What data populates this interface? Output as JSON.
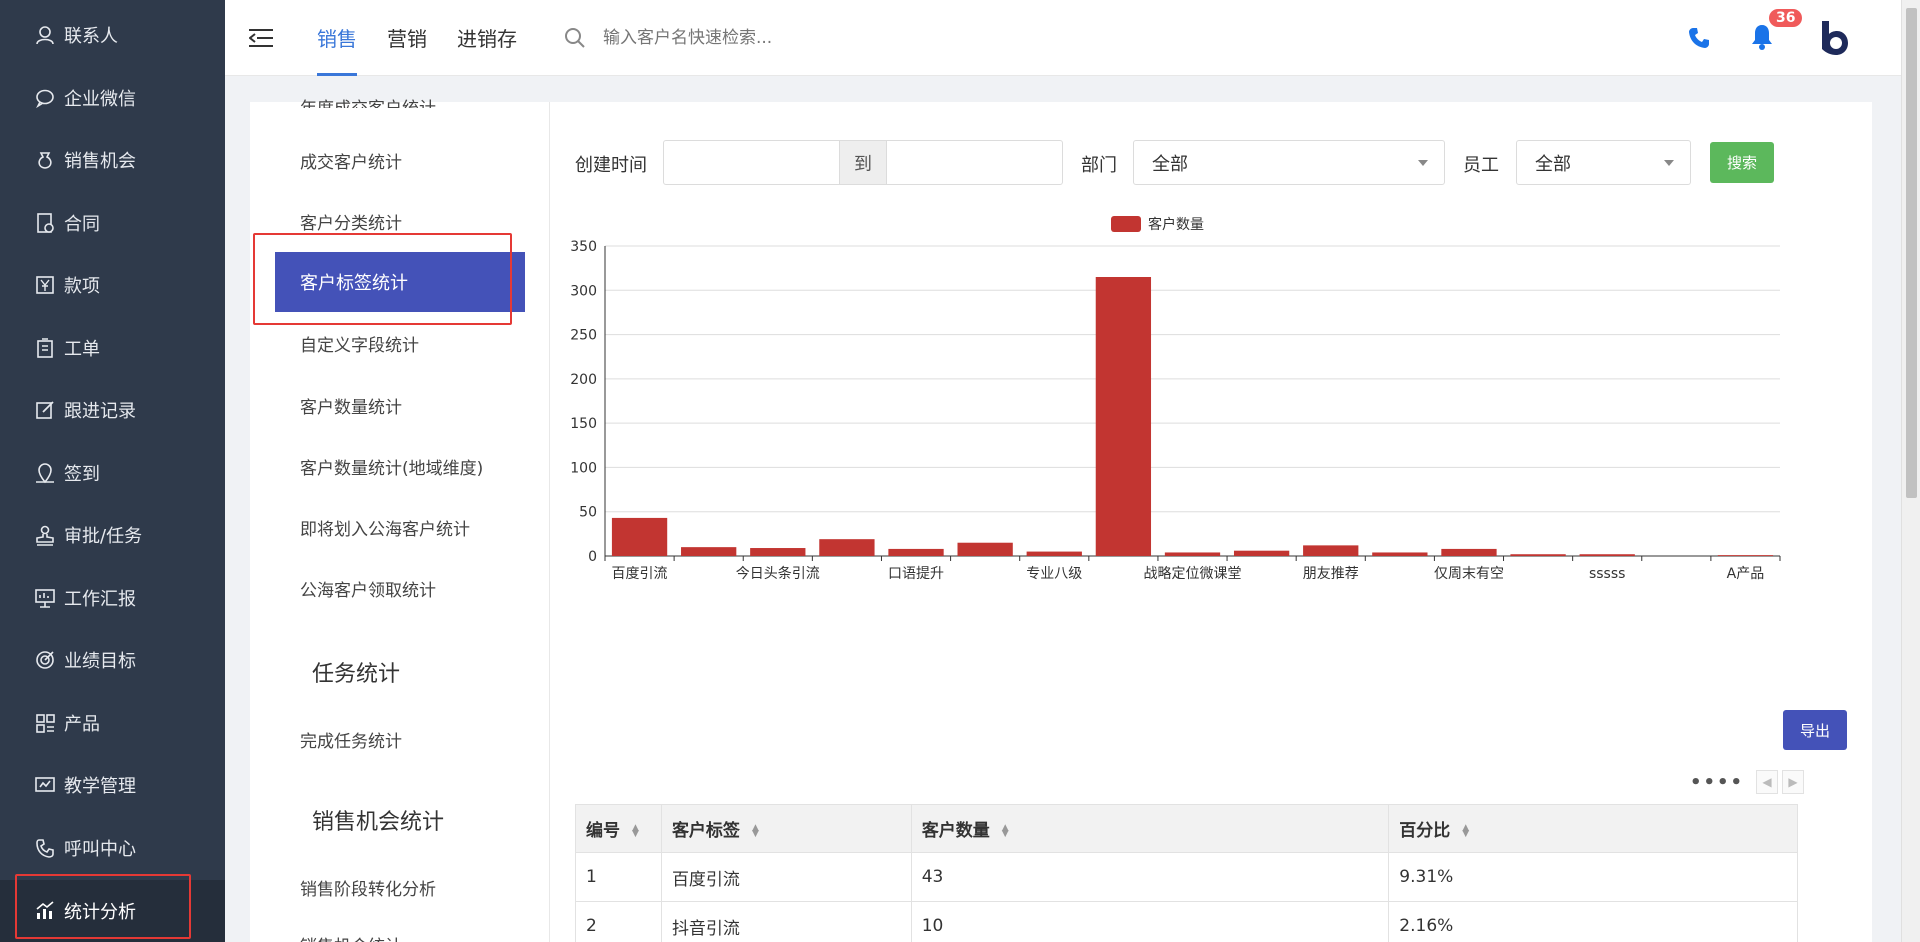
{
  "sidebar": {
    "items": [
      {
        "label": "联系人",
        "icon": "contacts-icon"
      },
      {
        "label": "企业微信",
        "icon": "wechat-icon"
      },
      {
        "label": "销售机会",
        "icon": "money-bag-icon"
      },
      {
        "label": "合同",
        "icon": "contract-icon"
      },
      {
        "label": "款项",
        "icon": "yuan-icon"
      },
      {
        "label": "工单",
        "icon": "clipboard-icon"
      },
      {
        "label": "跟进记录",
        "icon": "edit-note-icon"
      },
      {
        "label": "签到",
        "icon": "location-pin-icon"
      },
      {
        "label": "审批/任务",
        "icon": "stamp-icon"
      },
      {
        "label": "工作汇报",
        "icon": "report-board-icon"
      },
      {
        "label": "业绩目标",
        "icon": "target-icon"
      },
      {
        "label": "产品",
        "icon": "grid-icon"
      },
      {
        "label": "教学管理",
        "icon": "teaching-icon"
      },
      {
        "label": "呼叫中心",
        "icon": "call-center-icon"
      },
      {
        "label": "统计分析",
        "icon": "bar-chart-icon"
      }
    ]
  },
  "header": {
    "tabs": [
      "销售",
      "营销",
      "进销存"
    ],
    "search_placeholder": "输入客户名快速检索...",
    "notification_count": "36"
  },
  "subnav": {
    "clipped_top": "年度成交客户统计",
    "items": [
      "成交客户统计",
      "客户分类统计"
    ],
    "active": "客户标签统计",
    "items_after": [
      "自定义字段统计",
      "客户数量统计",
      "客户数量统计(地域维度)",
      "即将划入公海客户统计",
      "公海客户领取统计"
    ],
    "heading_tasks": "任务统计",
    "task_items": [
      "完成任务统计"
    ],
    "heading_sales": "销售机会统计",
    "sales_items": [
      "销售阶段转化分析",
      "销售机会统计"
    ]
  },
  "filters": {
    "created_time_label": "创建时间",
    "to_label": "到",
    "dept_label": "部门",
    "dept_value": "全部",
    "staff_label": "员工",
    "staff_value": "全部",
    "search_button": "搜索"
  },
  "chart_data": {
    "type": "bar",
    "legend": "客户数量",
    "color": "#c23531",
    "ylim": [
      0,
      350
    ],
    "yticks": [
      0,
      50,
      100,
      150,
      200,
      250,
      300,
      350
    ],
    "tick_labels": [
      "百度引流",
      "今日头条引流",
      "口语提升",
      "专业八级",
      "战略定位微课堂",
      "朋友推荐",
      "仅周末有空",
      "sssss",
      "A产品"
    ],
    "values": [
      43,
      10,
      9,
      19,
      8,
      15,
      5,
      315,
      4,
      6,
      12,
      4,
      8,
      2,
      2,
      0,
      1
    ]
  },
  "export_button": "导出",
  "table": {
    "headers": [
      "编号",
      "客户标签",
      "客户数量",
      "百分比"
    ],
    "rows": [
      [
        "1",
        "百度引流",
        "43",
        "9.31%"
      ],
      [
        "2",
        "抖音引流",
        "10",
        "2.16%"
      ]
    ]
  }
}
